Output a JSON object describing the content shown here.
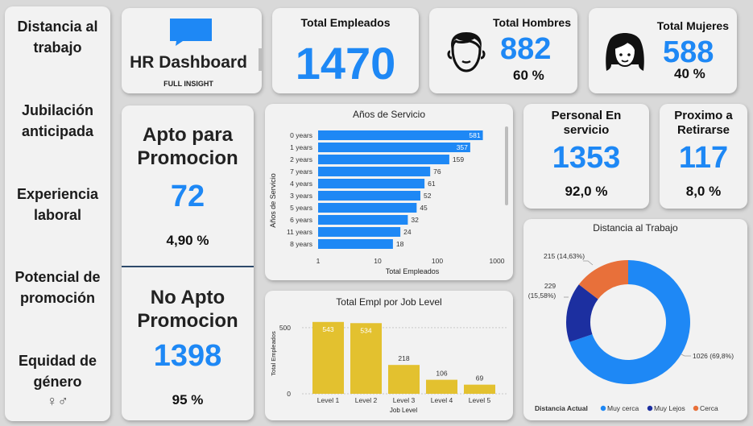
{
  "nav": {
    "items": [
      {
        "line1": "Distancia al",
        "line2": "trabajo"
      },
      {
        "line1": "Jubilación",
        "line2": "anticipada"
      },
      {
        "line1": "Experiencia",
        "line2": "laboral"
      },
      {
        "line1": "Potencial de",
        "line2": "promoción"
      },
      {
        "line1": "Equidad de",
        "line2": "género"
      }
    ],
    "gender_symbol": "♀♂"
  },
  "header": {
    "title": "HR Dashboard",
    "subtitle": "FULL INSIGHT",
    "logo_icon": "chat-bubble-icon"
  },
  "kpis": {
    "total_empleados": {
      "label": "Total Empleados",
      "value": "1470"
    },
    "total_hombres": {
      "label": "Total Hombres",
      "value": "882",
      "pct": "60 %",
      "icon": "man-icon"
    },
    "total_mujeres": {
      "label": "Total Mujeres",
      "value": "588",
      "pct": "40 %",
      "icon": "woman-icon"
    },
    "apto": {
      "line1": "Apto para",
      "line2": "Promocion",
      "value": "72",
      "pct": "4,90 %"
    },
    "no_apto": {
      "line1": "No Apto",
      "line2": "Promocion",
      "value": "1398",
      "pct": "95 %"
    },
    "personal": {
      "line1": "Personal En",
      "line2": "servicio",
      "value": "1353",
      "pct": "92,0 %"
    },
    "proximo": {
      "line1": "Proximo a",
      "line2": "Retirarse",
      "value": "117",
      "pct": "8,0 %"
    }
  },
  "colors": {
    "accent": "#1e88f5",
    "bar_blue": "#1e88f5",
    "bar_yellow": "#e3c12f",
    "donut_near": "#1e88f5",
    "donut_far": "#1c2fa0",
    "donut_close": "#e8703a"
  },
  "chart_data": [
    {
      "type": "bar",
      "orientation": "horizontal",
      "title": "Años de Servicio",
      "xlabel": "Total Empleados",
      "ylabel": "Años de Servicio",
      "x_scale": "log",
      "xticks": [
        "1",
        "10",
        "100",
        "1000"
      ],
      "categories": [
        "0 years",
        "1 years",
        "2 years",
        "7 years",
        "4 years",
        "3 years",
        "5 years",
        "6 years",
        "11 years",
        "8 years"
      ],
      "values": [
        581,
        357,
        159,
        76,
        61,
        52,
        45,
        32,
        24,
        18
      ]
    },
    {
      "type": "bar",
      "title": "Total Empl por Job Level",
      "xlabel": "Job Level",
      "ylabel": "Total Empleados",
      "yticks": [
        "0",
        "500"
      ],
      "ylim": [
        0,
        560
      ],
      "categories": [
        "Level 1",
        "Level 2",
        "Level 3",
        "Level 4",
        "Level 5"
      ],
      "values": [
        543,
        534,
        218,
        106,
        69
      ]
    },
    {
      "type": "pie",
      "donut": true,
      "title": "Distancia al Trabajo",
      "legend_title": "Distancia Actual",
      "legend_position": "bottom",
      "categories": [
        "Muy cerca",
        "Muy Lejos",
        "Cerca"
      ],
      "values": [
        1026,
        229,
        215
      ],
      "labels": [
        "1026 (69,8%)",
        "229 (15,58%)",
        "215 (14,63%)"
      ]
    }
  ]
}
